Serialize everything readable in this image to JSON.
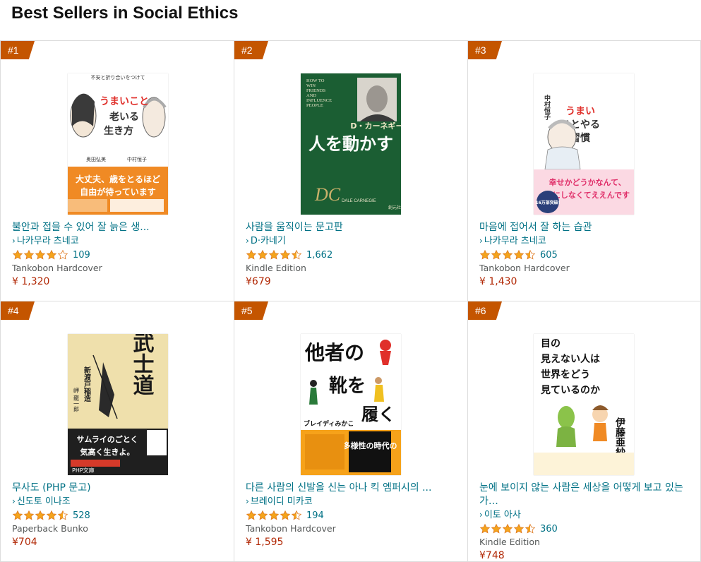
{
  "page": {
    "heading": "Best Sellers in Social Ethics"
  },
  "colors": {
    "rank_badge": "#c45500",
    "link": "#007185",
    "price": "#b12704",
    "star": "#f4a41c"
  },
  "books": [
    {
      "rank": "#1",
      "title": "불안과 접을 수 있어 잘 늙은 생...",
      "author": "나카무라 츠네코",
      "rating": 4.0,
      "reviews": "109",
      "format": "Tankobon Hardcover",
      "price": "¥ 1,320",
      "cover": {
        "top_text": "不安と折り合いをつけて",
        "title_line1": "うまいこと",
        "title_line2": "老いる",
        "title_line3": "生き方",
        "author_a": "奥田弘美",
        "author_b": "中村恒子",
        "band_line1": "大丈夫、歳をとるほど",
        "band_line2": "自由が待っています"
      }
    },
    {
      "rank": "#2",
      "title": "사람을 움직이는 문고판",
      "author": "D·카네기",
      "rating": 4.5,
      "reviews": "1,662",
      "format": "Kindle Edition",
      "price": "¥679",
      "cover": {
        "en_line1": "HOW TO",
        "en_line2": "WIN",
        "en_line3": "FRIENDS",
        "en_line4": "AND",
        "en_line5": "INFLUENCE",
        "en_line6": "PEOPLE",
        "author": "D・カーネギー",
        "title": "人を動かす",
        "sign": "DALE CARNEGIE",
        "publisher": "創元社"
      }
    },
    {
      "rank": "#3",
      "title": "마음에 접어서 잘 하는 습관",
      "author": "나카무라 츠네코",
      "rating": 4.5,
      "reviews": "605",
      "format": "Tankobon Hardcover",
      "price": "¥ 1,430",
      "cover": {
        "author": "中村恒子",
        "title_a": "うまい",
        "title_b": "ことやる",
        "title_c": "習慣",
        "band_line1": "幸せかどうかなんて、",
        "band_line2": "気にしなくてええんです",
        "badge": "16万部突破!"
      }
    },
    {
      "rank": "#4",
      "title": "무사도 (PHP 문고)",
      "author": "신도토 이나조",
      "rating": 4.5,
      "reviews": "528",
      "format": "Paperback Bunko",
      "price": "¥704",
      "cover": {
        "title": "武士道",
        "author": "新渡戸稲造",
        "translator": "岬 龍一郎",
        "band_line1": "サムライのごとく",
        "band_line2": "気高く生きよ。",
        "publisher": "PHP文庫"
      }
    },
    {
      "rank": "#5",
      "title": "다른 사람의 신발을 신는 아나 킥 엠퍼시의 ...",
      "author": "브레이디 미카코",
      "rating": 4.5,
      "reviews": "194",
      "format": "Tankobon Hardcover",
      "price": "¥ 1,595",
      "cover": {
        "t1": "他者の",
        "t2": "靴を",
        "t3": "履く",
        "author": "ブレイディみかこ",
        "band": "多様性の時代の"
      }
    },
    {
      "rank": "#6",
      "title": "눈에 보이지 않는 사람은 세상을 어떻게 보고 있는가…",
      "author": "이토 아사",
      "rating": 4.5,
      "reviews": "360",
      "format": "Kindle Edition",
      "price": "¥748",
      "cover": {
        "line1": "目の",
        "line2": "見えない人は",
        "line3": "世界をどう",
        "line4": "見ているのか",
        "author": "伊藤亜紗"
      }
    }
  ]
}
